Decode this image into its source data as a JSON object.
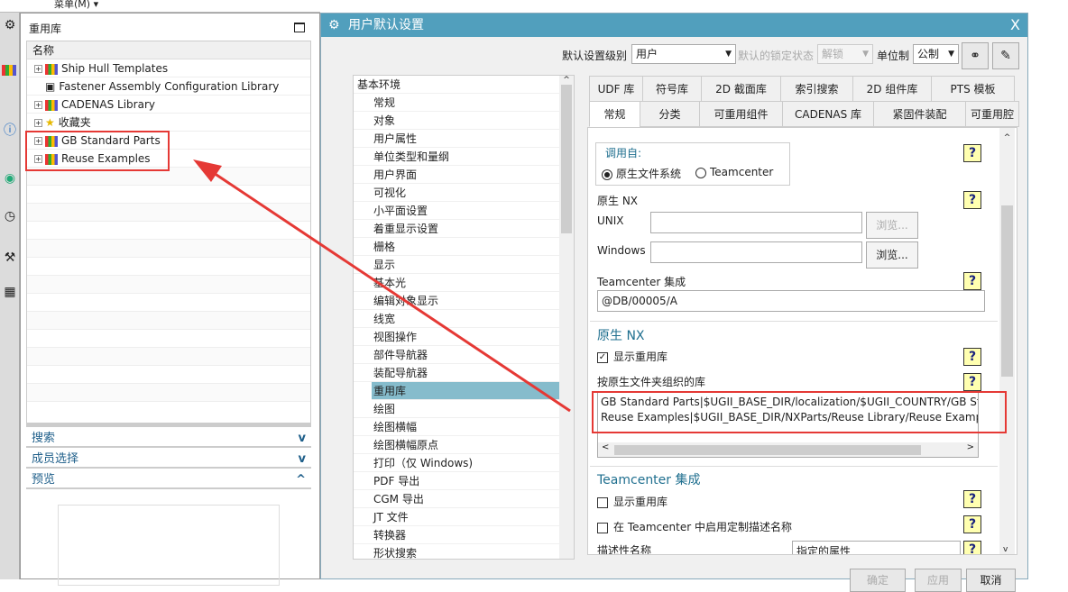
{
  "topbar": {
    "menu": "菜单(M) ▾"
  },
  "left_panel": {
    "title": "重用库",
    "tree_header": "名称",
    "items": [
      {
        "label": "Ship Hull Templates",
        "expandable": true,
        "icon": "library-icon"
      },
      {
        "label": "Fastener Assembly Configuration Library",
        "expandable": false,
        "icon": "fastener-library-icon"
      },
      {
        "label": "CADENAS Library",
        "expandable": true,
        "icon": "library-icon"
      },
      {
        "label": "收藏夹",
        "expandable": true,
        "icon": "star-icon"
      },
      {
        "label": "GB Standard Parts",
        "expandable": true,
        "icon": "library-icon"
      },
      {
        "label": "Reuse Examples",
        "expandable": true,
        "icon": "library-icon"
      }
    ],
    "sections": [
      {
        "label": "搜索",
        "state": "collapsed"
      },
      {
        "label": "成员选择",
        "state": "collapsed"
      },
      {
        "label": "预览",
        "state": "expanded"
      }
    ]
  },
  "dialog": {
    "title": "用户默认设置",
    "close": "X",
    "toolbar": {
      "level_label": "默认设置级别",
      "level_value": "用户",
      "lock_label": "默认的锁定状态",
      "lock_value": "解锁",
      "unit_label": "单位制",
      "unit_value": "公制"
    },
    "nav": [
      "基本环境",
      "常规",
      "对象",
      "用户属性",
      "单位类型和量纲",
      "用户界面",
      "可视化",
      "小平面设置",
      "着重显示设置",
      "栅格",
      "显示",
      "基本光",
      "编辑对象显示",
      "线宽",
      "视图操作",
      "部件导航器",
      "装配导航器",
      "重用库",
      "绘图",
      "绘图横幅",
      "绘图横幅原点",
      "打印（仅 Windows)",
      "PDF 导出",
      "CGM 导出",
      "JT 文件",
      "转换器",
      "形状搜索"
    ],
    "nav_selected": "重用库",
    "tabs_row1": [
      "UDF 库",
      "符号库",
      "2D 截面库",
      "索引搜索",
      "2D 组件库",
      "PTS 模板"
    ],
    "tabs_row2": [
      "常规",
      "分类",
      "可重用组件",
      "CADENAS 库",
      "紧固件装配",
      "可重用腔"
    ],
    "active_tab": "常规",
    "content": {
      "call_from_label": "调用自:",
      "radio_native": "原生文件系统",
      "radio_tc": "Teamcenter",
      "radio_selected": "原生文件系统",
      "native_nx_label": "原生 NX",
      "unix_label": "UNIX",
      "unix_value": "",
      "windows_label": "Windows",
      "windows_value": "",
      "browse": "浏览...",
      "tc_integration_label": "Teamcenter 集成",
      "tc_value": "@DB/00005/A",
      "native_group": "原生 NX",
      "show_reuse": "显示重用库",
      "show_reuse_checked": true,
      "native_lib_label": "按原生文件夹组织的库",
      "native_lib_lines": [
        "GB Standard Parts|$UGII_BASE_DIR/localization/$UGII_COUNTRY/GB Star",
        "Reuse Examples|$UGII_BASE_DIR/NXParts/Reuse Library/Reuse Examples"
      ],
      "tc_group": "Teamcenter 集成",
      "tc_show_reuse": "显示重用库",
      "tc_custom_desc": "在 Teamcenter 中启用定制描述名称",
      "desc_name_label": "描述性名称",
      "desc_name_value": "指定的属性",
      "help": "?"
    },
    "buttons": {
      "ok": "确定",
      "apply": "应用",
      "cancel": "取消"
    }
  },
  "colors": {
    "title_bar": "#519fbd",
    "selection": "#86bccc",
    "annotation": "#e53935"
  }
}
